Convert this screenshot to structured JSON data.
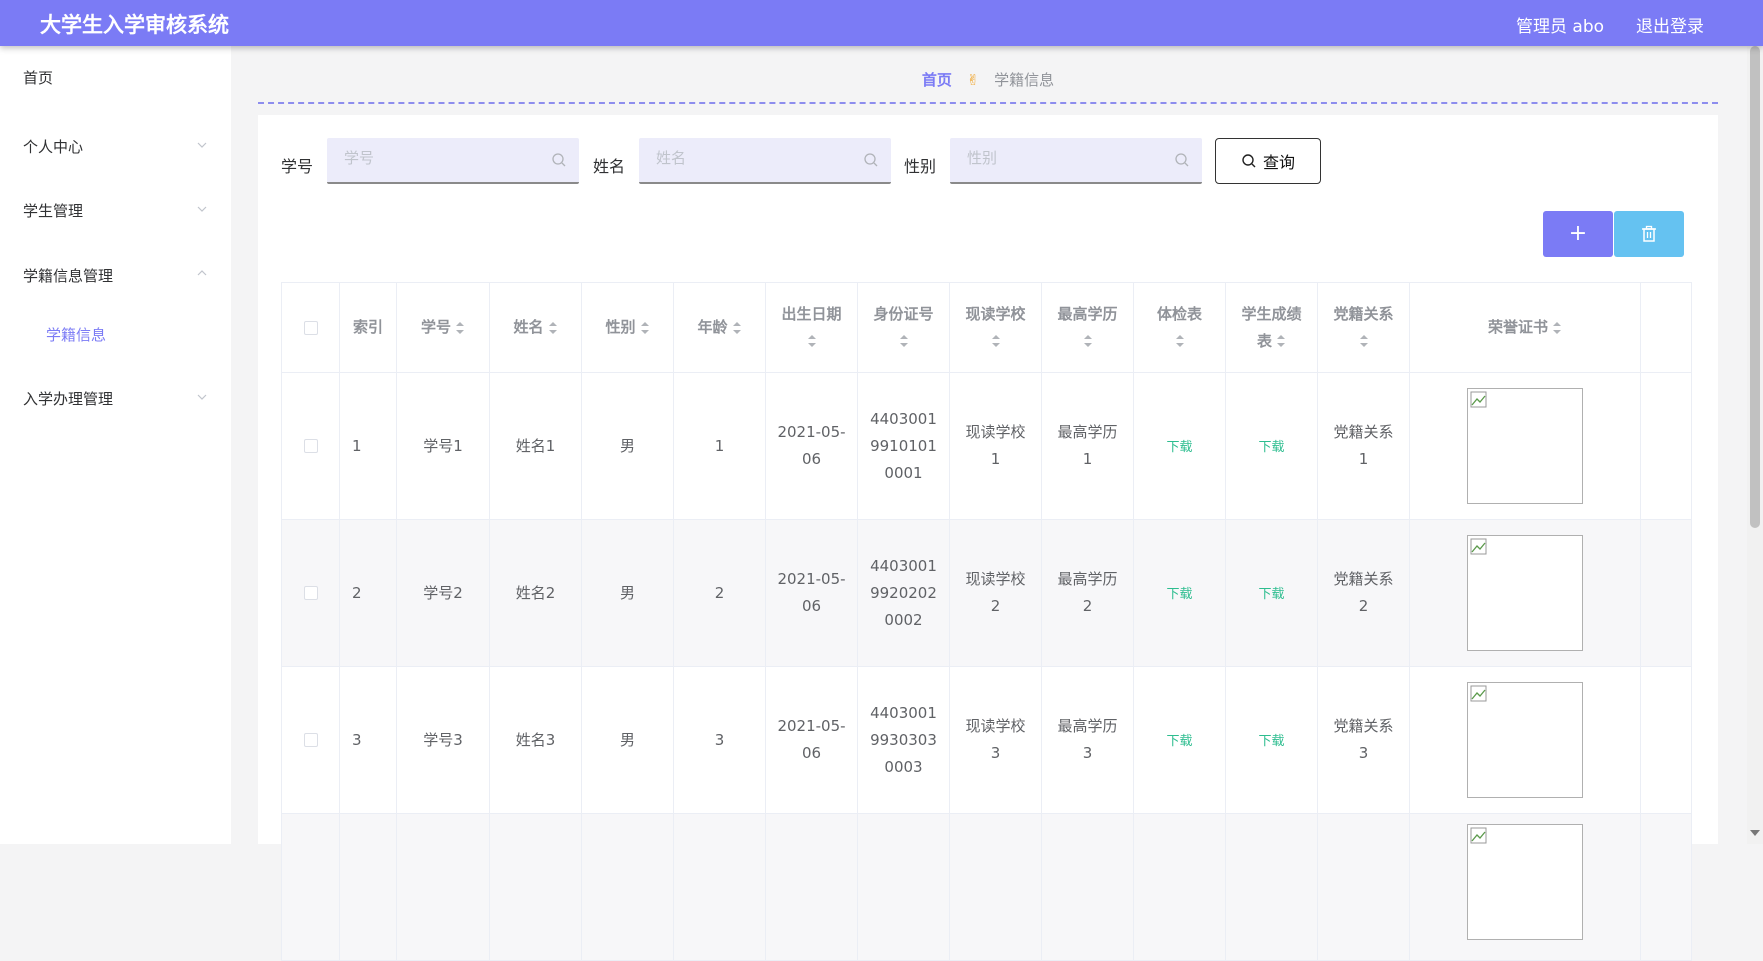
{
  "header": {
    "title": "大学生入学审核系统",
    "user": "管理员 abo",
    "logout": "退出登录"
  },
  "sidebar": {
    "items": [
      {
        "label": "首页"
      },
      {
        "label": "个人中心"
      },
      {
        "label": "学生管理"
      },
      {
        "label": "学籍信息管理"
      },
      {
        "label": "学籍信息"
      },
      {
        "label": "入学办理管理"
      }
    ]
  },
  "breadcrumb": {
    "home": "首页",
    "separator": "✌",
    "current": "学籍信息"
  },
  "search": {
    "student_id_label": "学号",
    "student_id_placeholder": "学号",
    "name_label": "姓名",
    "name_placeholder": "姓名",
    "gender_label": "性别",
    "gender_placeholder": "性别",
    "query_label": "查询"
  },
  "toolbar": {
    "add_label": "+"
  },
  "table": {
    "headers": {
      "index": "索引",
      "student_id": "学号",
      "name": "姓名",
      "gender": "性别",
      "age": "年龄",
      "birth_a": "出生日期",
      "idcard_a": "身份证号",
      "school_a": "现读学校",
      "edu_a": "最高学历",
      "health_a": "体检表",
      "score_a": "学生成绩",
      "score_b": "表",
      "party_a": "党籍关系",
      "honor": "荣誉证书"
    },
    "rows": [
      {
        "index": "1",
        "student_id": "学号1",
        "name": "姓名1",
        "gender": "男",
        "age": "1",
        "birth_a": "2021-05-",
        "birth_b": "06",
        "id_a": "4403001",
        "id_b": "9910101",
        "id_c": "0001",
        "school_a": "现读学校",
        "school_b": "1",
        "edu_a": "最高学历",
        "edu_b": "1",
        "health": "下载",
        "score": "下载",
        "party_a": "党籍关系",
        "party_b": "1"
      },
      {
        "index": "2",
        "student_id": "学号2",
        "name": "姓名2",
        "gender": "男",
        "age": "2",
        "birth_a": "2021-05-",
        "birth_b": "06",
        "id_a": "4403001",
        "id_b": "9920202",
        "id_c": "0002",
        "school_a": "现读学校",
        "school_b": "2",
        "edu_a": "最高学历",
        "edu_b": "2",
        "health": "下载",
        "score": "下载",
        "party_a": "党籍关系",
        "party_b": "2"
      },
      {
        "index": "3",
        "student_id": "学号3",
        "name": "姓名3",
        "gender": "男",
        "age": "3",
        "birth_a": "2021-05-",
        "birth_b": "06",
        "id_a": "4403001",
        "id_b": "9930303",
        "id_c": "0003",
        "school_a": "现读学校",
        "school_b": "3",
        "edu_a": "最高学历",
        "edu_b": "3",
        "health": "下载",
        "score": "下载",
        "party_a": "党籍关系",
        "party_b": "3"
      }
    ]
  },
  "colors": {
    "accent": "#7b7bf5",
    "delete": "#65c2f1",
    "download": "#2dbd8f"
  },
  "icons": [
    "search-icon",
    "trash-icon",
    "chevron-down-icon",
    "chevron-up-icon",
    "sort-icon",
    "broken-image-icon"
  ]
}
